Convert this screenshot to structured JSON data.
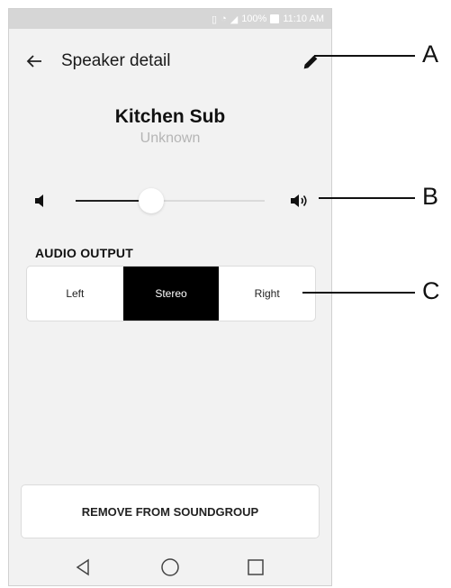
{
  "status_bar": {
    "battery": "100%",
    "time": "11:10 AM"
  },
  "header": {
    "title": "Speaker detail",
    "back_icon": "arrow-left-icon",
    "edit_icon": "pencil-icon"
  },
  "speaker": {
    "name": "Kitchen Sub",
    "status": "Unknown"
  },
  "volume": {
    "level": 0.4,
    "low_icon": "volume-low-icon",
    "high_icon": "volume-high-icon"
  },
  "audio_output": {
    "label": "AUDIO OUTPUT",
    "options": [
      "Left",
      "Stereo",
      "Right"
    ],
    "selected": "Stereo"
  },
  "actions": {
    "remove_label": "REMOVE FROM SOUNDGROUP"
  },
  "nav": {
    "back_icon": "triangle-back-icon",
    "home_icon": "circle-home-icon",
    "recents_icon": "square-recents-icon"
  },
  "callouts": {
    "a": "A",
    "b": "B",
    "c": "C"
  },
  "colors": {
    "background": "#f2f2f2",
    "selected_segment": "#000000",
    "muted_text": "#b5b5b5"
  }
}
